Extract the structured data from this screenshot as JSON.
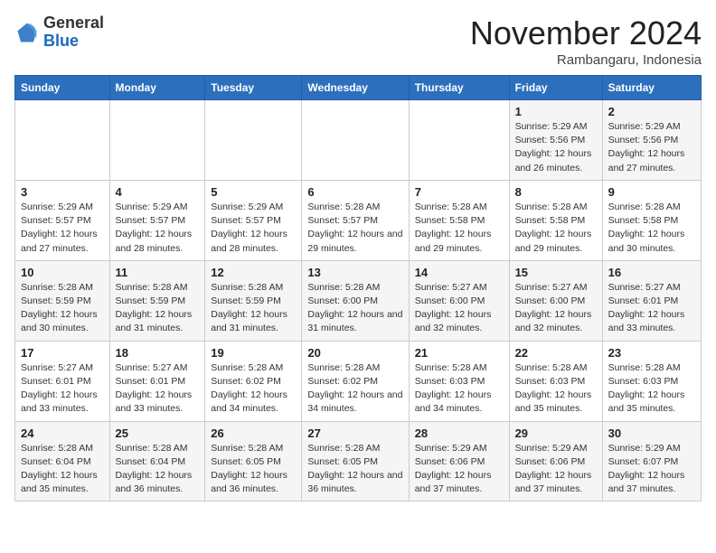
{
  "header": {
    "logo_general": "General",
    "logo_blue": "Blue",
    "month_title": "November 2024",
    "location": "Rambangaru, Indonesia"
  },
  "weekdays": [
    "Sunday",
    "Monday",
    "Tuesday",
    "Wednesday",
    "Thursday",
    "Friday",
    "Saturday"
  ],
  "weeks": [
    [
      {
        "day": "",
        "sunrise": "",
        "sunset": "",
        "daylight": ""
      },
      {
        "day": "",
        "sunrise": "",
        "sunset": "",
        "daylight": ""
      },
      {
        "day": "",
        "sunrise": "",
        "sunset": "",
        "daylight": ""
      },
      {
        "day": "",
        "sunrise": "",
        "sunset": "",
        "daylight": ""
      },
      {
        "day": "",
        "sunrise": "",
        "sunset": "",
        "daylight": ""
      },
      {
        "day": "1",
        "sunrise": "Sunrise: 5:29 AM",
        "sunset": "Sunset: 5:56 PM",
        "daylight": "Daylight: 12 hours and 26 minutes."
      },
      {
        "day": "2",
        "sunrise": "Sunrise: 5:29 AM",
        "sunset": "Sunset: 5:56 PM",
        "daylight": "Daylight: 12 hours and 27 minutes."
      }
    ],
    [
      {
        "day": "3",
        "sunrise": "Sunrise: 5:29 AM",
        "sunset": "Sunset: 5:57 PM",
        "daylight": "Daylight: 12 hours and 27 minutes."
      },
      {
        "day": "4",
        "sunrise": "Sunrise: 5:29 AM",
        "sunset": "Sunset: 5:57 PM",
        "daylight": "Daylight: 12 hours and 28 minutes."
      },
      {
        "day": "5",
        "sunrise": "Sunrise: 5:29 AM",
        "sunset": "Sunset: 5:57 PM",
        "daylight": "Daylight: 12 hours and 28 minutes."
      },
      {
        "day": "6",
        "sunrise": "Sunrise: 5:28 AM",
        "sunset": "Sunset: 5:57 PM",
        "daylight": "Daylight: 12 hours and 29 minutes."
      },
      {
        "day": "7",
        "sunrise": "Sunrise: 5:28 AM",
        "sunset": "Sunset: 5:58 PM",
        "daylight": "Daylight: 12 hours and 29 minutes."
      },
      {
        "day": "8",
        "sunrise": "Sunrise: 5:28 AM",
        "sunset": "Sunset: 5:58 PM",
        "daylight": "Daylight: 12 hours and 29 minutes."
      },
      {
        "day": "9",
        "sunrise": "Sunrise: 5:28 AM",
        "sunset": "Sunset: 5:58 PM",
        "daylight": "Daylight: 12 hours and 30 minutes."
      }
    ],
    [
      {
        "day": "10",
        "sunrise": "Sunrise: 5:28 AM",
        "sunset": "Sunset: 5:59 PM",
        "daylight": "Daylight: 12 hours and 30 minutes."
      },
      {
        "day": "11",
        "sunrise": "Sunrise: 5:28 AM",
        "sunset": "Sunset: 5:59 PM",
        "daylight": "Daylight: 12 hours and 31 minutes."
      },
      {
        "day": "12",
        "sunrise": "Sunrise: 5:28 AM",
        "sunset": "Sunset: 5:59 PM",
        "daylight": "Daylight: 12 hours and 31 minutes."
      },
      {
        "day": "13",
        "sunrise": "Sunrise: 5:28 AM",
        "sunset": "Sunset: 6:00 PM",
        "daylight": "Daylight: 12 hours and 31 minutes."
      },
      {
        "day": "14",
        "sunrise": "Sunrise: 5:27 AM",
        "sunset": "Sunset: 6:00 PM",
        "daylight": "Daylight: 12 hours and 32 minutes."
      },
      {
        "day": "15",
        "sunrise": "Sunrise: 5:27 AM",
        "sunset": "Sunset: 6:00 PM",
        "daylight": "Daylight: 12 hours and 32 minutes."
      },
      {
        "day": "16",
        "sunrise": "Sunrise: 5:27 AM",
        "sunset": "Sunset: 6:01 PM",
        "daylight": "Daylight: 12 hours and 33 minutes."
      }
    ],
    [
      {
        "day": "17",
        "sunrise": "Sunrise: 5:27 AM",
        "sunset": "Sunset: 6:01 PM",
        "daylight": "Daylight: 12 hours and 33 minutes."
      },
      {
        "day": "18",
        "sunrise": "Sunrise: 5:27 AM",
        "sunset": "Sunset: 6:01 PM",
        "daylight": "Daylight: 12 hours and 33 minutes."
      },
      {
        "day": "19",
        "sunrise": "Sunrise: 5:28 AM",
        "sunset": "Sunset: 6:02 PM",
        "daylight": "Daylight: 12 hours and 34 minutes."
      },
      {
        "day": "20",
        "sunrise": "Sunrise: 5:28 AM",
        "sunset": "Sunset: 6:02 PM",
        "daylight": "Daylight: 12 hours and 34 minutes."
      },
      {
        "day": "21",
        "sunrise": "Sunrise: 5:28 AM",
        "sunset": "Sunset: 6:03 PM",
        "daylight": "Daylight: 12 hours and 34 minutes."
      },
      {
        "day": "22",
        "sunrise": "Sunrise: 5:28 AM",
        "sunset": "Sunset: 6:03 PM",
        "daylight": "Daylight: 12 hours and 35 minutes."
      },
      {
        "day": "23",
        "sunrise": "Sunrise: 5:28 AM",
        "sunset": "Sunset: 6:03 PM",
        "daylight": "Daylight: 12 hours and 35 minutes."
      }
    ],
    [
      {
        "day": "24",
        "sunrise": "Sunrise: 5:28 AM",
        "sunset": "Sunset: 6:04 PM",
        "daylight": "Daylight: 12 hours and 35 minutes."
      },
      {
        "day": "25",
        "sunrise": "Sunrise: 5:28 AM",
        "sunset": "Sunset: 6:04 PM",
        "daylight": "Daylight: 12 hours and 36 minutes."
      },
      {
        "day": "26",
        "sunrise": "Sunrise: 5:28 AM",
        "sunset": "Sunset: 6:05 PM",
        "daylight": "Daylight: 12 hours and 36 minutes."
      },
      {
        "day": "27",
        "sunrise": "Sunrise: 5:28 AM",
        "sunset": "Sunset: 6:05 PM",
        "daylight": "Daylight: 12 hours and 36 minutes."
      },
      {
        "day": "28",
        "sunrise": "Sunrise: 5:29 AM",
        "sunset": "Sunset: 6:06 PM",
        "daylight": "Daylight: 12 hours and 37 minutes."
      },
      {
        "day": "29",
        "sunrise": "Sunrise: 5:29 AM",
        "sunset": "Sunset: 6:06 PM",
        "daylight": "Daylight: 12 hours and 37 minutes."
      },
      {
        "day": "30",
        "sunrise": "Sunrise: 5:29 AM",
        "sunset": "Sunset: 6:07 PM",
        "daylight": "Daylight: 12 hours and 37 minutes."
      }
    ]
  ]
}
